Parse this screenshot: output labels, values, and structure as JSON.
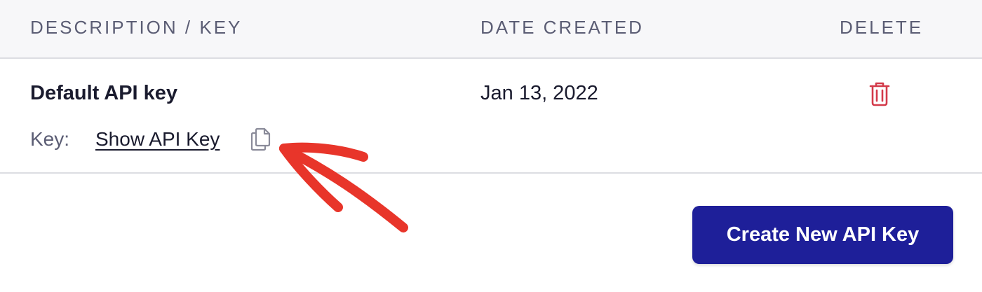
{
  "table": {
    "headers": {
      "description": "DESCRIPTION / KEY",
      "date": "DATE CREATED",
      "delete": "DELETE"
    },
    "rows": [
      {
        "description": "Default API key",
        "date_created": "Jan 13, 2022",
        "key_label": "Key:",
        "show_key_link": "Show API Key"
      }
    ]
  },
  "actions": {
    "create_button": "Create New API Key"
  },
  "icons": {
    "delete": "trash-icon",
    "copy": "copy-icon",
    "annotation": "arrow-annotation-icon"
  },
  "colors": {
    "header_bg": "#f7f7f9",
    "header_text": "#5b5d74",
    "primary_text": "#1a1b2e",
    "delete_icon": "#d33a4a",
    "primary_button": "#1e1f99",
    "annotation_arrow": "#e8352a"
  }
}
